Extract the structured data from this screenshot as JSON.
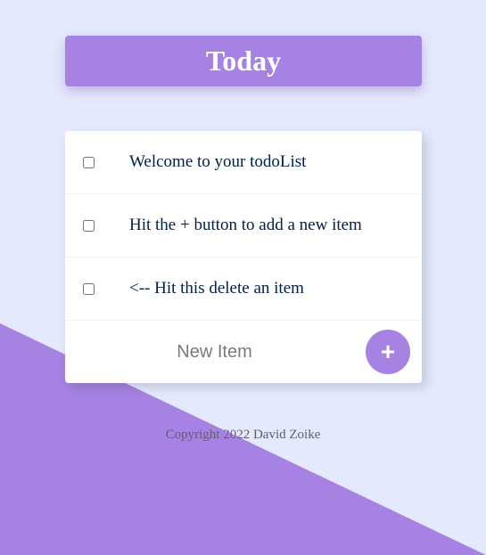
{
  "colors": {
    "background": "#E4E9FD",
    "accent": "#A683E3",
    "text": "#00204A",
    "card": "#FFFFFF"
  },
  "header": {
    "title": "Today"
  },
  "todo": {
    "items": [
      {
        "label": "Welcome to your todoList",
        "checked": false
      },
      {
        "label": "Hit the + button to add a new item",
        "checked": false
      },
      {
        "label": "<-- Hit this delete an item",
        "checked": false
      }
    ],
    "new_item": {
      "placeholder": "New Item",
      "value": "",
      "add_button_label": "+"
    }
  },
  "footer": {
    "copyright": "Copyright 2022 David Zoike"
  }
}
